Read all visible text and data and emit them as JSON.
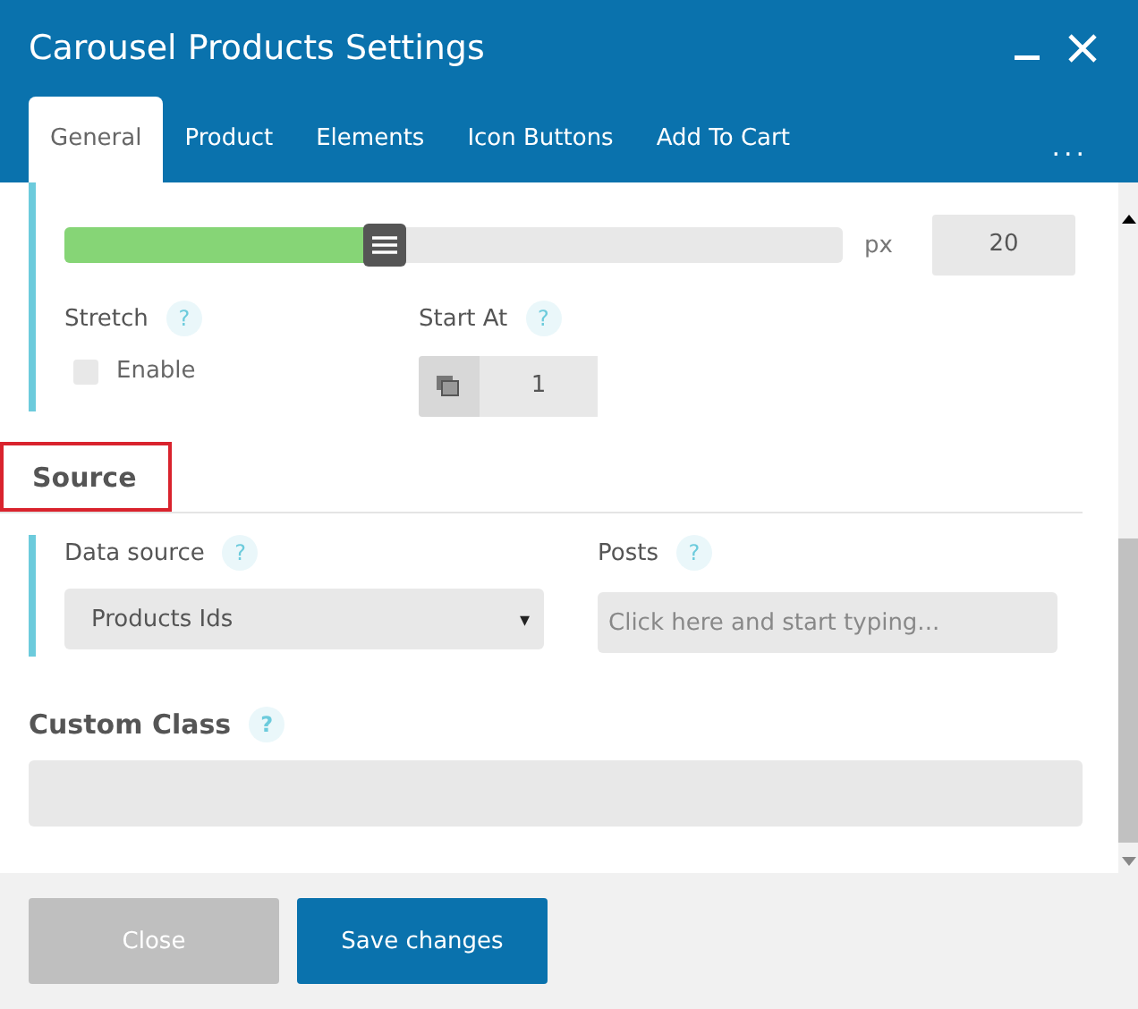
{
  "window": {
    "title": "Carousel Products Settings"
  },
  "tabs": [
    {
      "label": "General",
      "selected": true
    },
    {
      "label": "Product",
      "selected": false
    },
    {
      "label": "Elements",
      "selected": false
    },
    {
      "label": "Icon Buttons",
      "selected": false
    },
    {
      "label": "Add To Cart",
      "selected": false
    }
  ],
  "more_tabs": "...",
  "gap": {
    "level": 0.41,
    "unit": "px",
    "value": "20"
  },
  "stretch": {
    "label": "Stretch",
    "help": "?",
    "option": "Enable",
    "checked": false
  },
  "start_at": {
    "label": "Start At",
    "help": "?",
    "value": "1"
  },
  "source": {
    "heading": "Source",
    "highlighted": true,
    "data_source": {
      "label": "Data source",
      "help": "?",
      "value": "Products Ids",
      "caret": "▾"
    },
    "posts": {
      "label": "Posts",
      "help": "?",
      "placeholder": "Click here and start typing..."
    }
  },
  "custom_class": {
    "label": "Custom Class",
    "help": "?"
  },
  "buttons": [
    {
      "label": "Close",
      "kind": "secondary"
    },
    {
      "label": "Save changes",
      "kind": "primary"
    }
  ]
}
